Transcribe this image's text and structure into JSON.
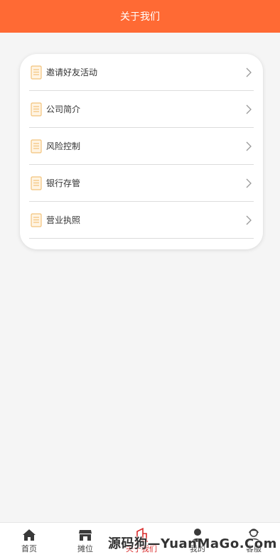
{
  "header": {
    "title": "关于我们"
  },
  "menu": {
    "items": [
      {
        "label": "邀请好友活动",
        "icon": "document-icon"
      },
      {
        "label": "公司简介",
        "icon": "document-icon"
      },
      {
        "label": "风险控制",
        "icon": "document-icon"
      },
      {
        "label": "银行存管",
        "icon": "document-icon"
      },
      {
        "label": "营业执照",
        "icon": "document-icon"
      }
    ]
  },
  "tabbar": {
    "active_color": "#d92b2b",
    "items": [
      {
        "label": "首页",
        "icon": "home-icon"
      },
      {
        "label": "摊位",
        "icon": "shop-icon"
      },
      {
        "label": "关于我们",
        "icon": "building-icon"
      },
      {
        "label": "我的",
        "icon": "user-icon"
      },
      {
        "label": "客服",
        "icon": "customer-service-icon"
      }
    ]
  },
  "watermark": "源码狗—YuanMaGo.Com",
  "colors": {
    "header_bg": "#ff6a34",
    "page_bg": "#f5f5f5",
    "icon_doc": "#f2c27a"
  }
}
